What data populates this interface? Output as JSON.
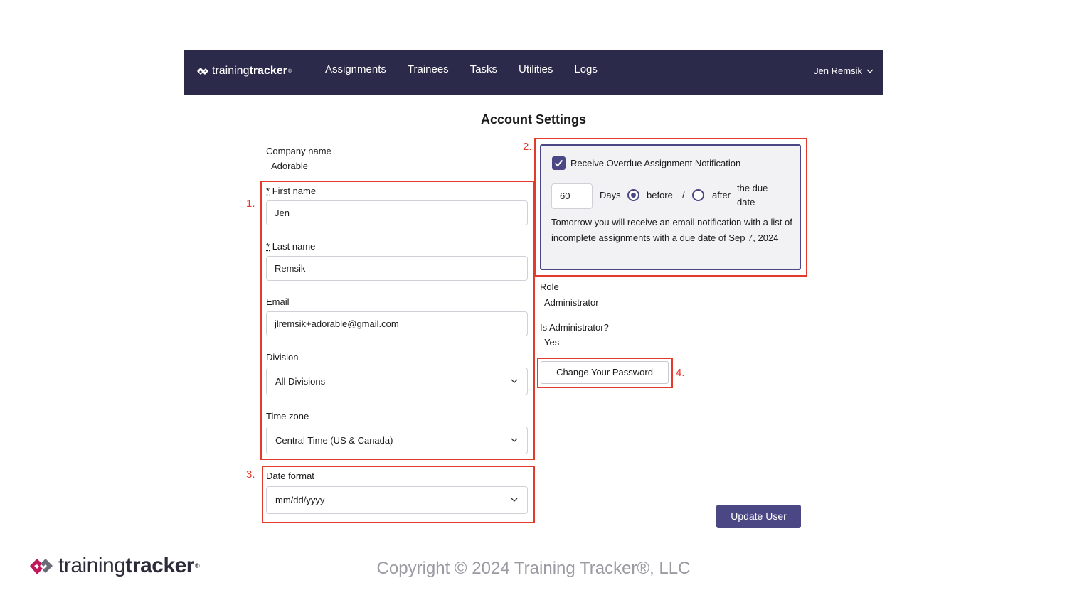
{
  "nav": {
    "logo_light": "training",
    "logo_bold": "tracker",
    "logo_mark": "®",
    "links": [
      "Assignments",
      "Trainees",
      "Tasks",
      "Utilities",
      "Logs"
    ],
    "user": "Jen Remsik"
  },
  "page_title": "Account Settings",
  "form": {
    "company_label": "Company name",
    "company_value": "Adorable",
    "required_mark": "*",
    "first_name_label": "First name",
    "first_name_value": "Jen",
    "last_name_label": "Last name",
    "last_name_value": "Remsik",
    "email_label": "Email",
    "email_value": "jlremsik+adorable@gmail.com",
    "division_label": "Division",
    "division_value": "All Divisions",
    "timezone_label": "Time zone",
    "timezone_value": "Central Time (US & Canada)",
    "date_format_label": "Date format",
    "date_format_value": "mm/dd/yyyy"
  },
  "notification": {
    "checked": true,
    "title": "Receive Overdue Assignment Notification",
    "days_value": "60",
    "days_label": "Days",
    "before_label": "before",
    "separator": "/",
    "after_label": "after",
    "due_label": "the due date",
    "selected": "before",
    "message": "Tomorrow you will receive an email notification with a list of incomplete assignments with a due date of Sep 7, 2024"
  },
  "role_label": "Role",
  "role_value": "Administrator",
  "is_admin_label": "Is Administrator?",
  "is_admin_value": "Yes",
  "change_password_label": "Change Your Password",
  "update_label": "Update User",
  "callouts": [
    "1.",
    "2.",
    "3.",
    "4."
  ],
  "callout_color": "#e23b2b",
  "accent_color": "#4b4785",
  "nav_color": "#2c2a4a",
  "footer": {
    "logo_light": "training",
    "logo_bold": "tracker",
    "logo_mark": "®",
    "copyright": "Copyright © 2024 Training Tracker®, LLC"
  }
}
